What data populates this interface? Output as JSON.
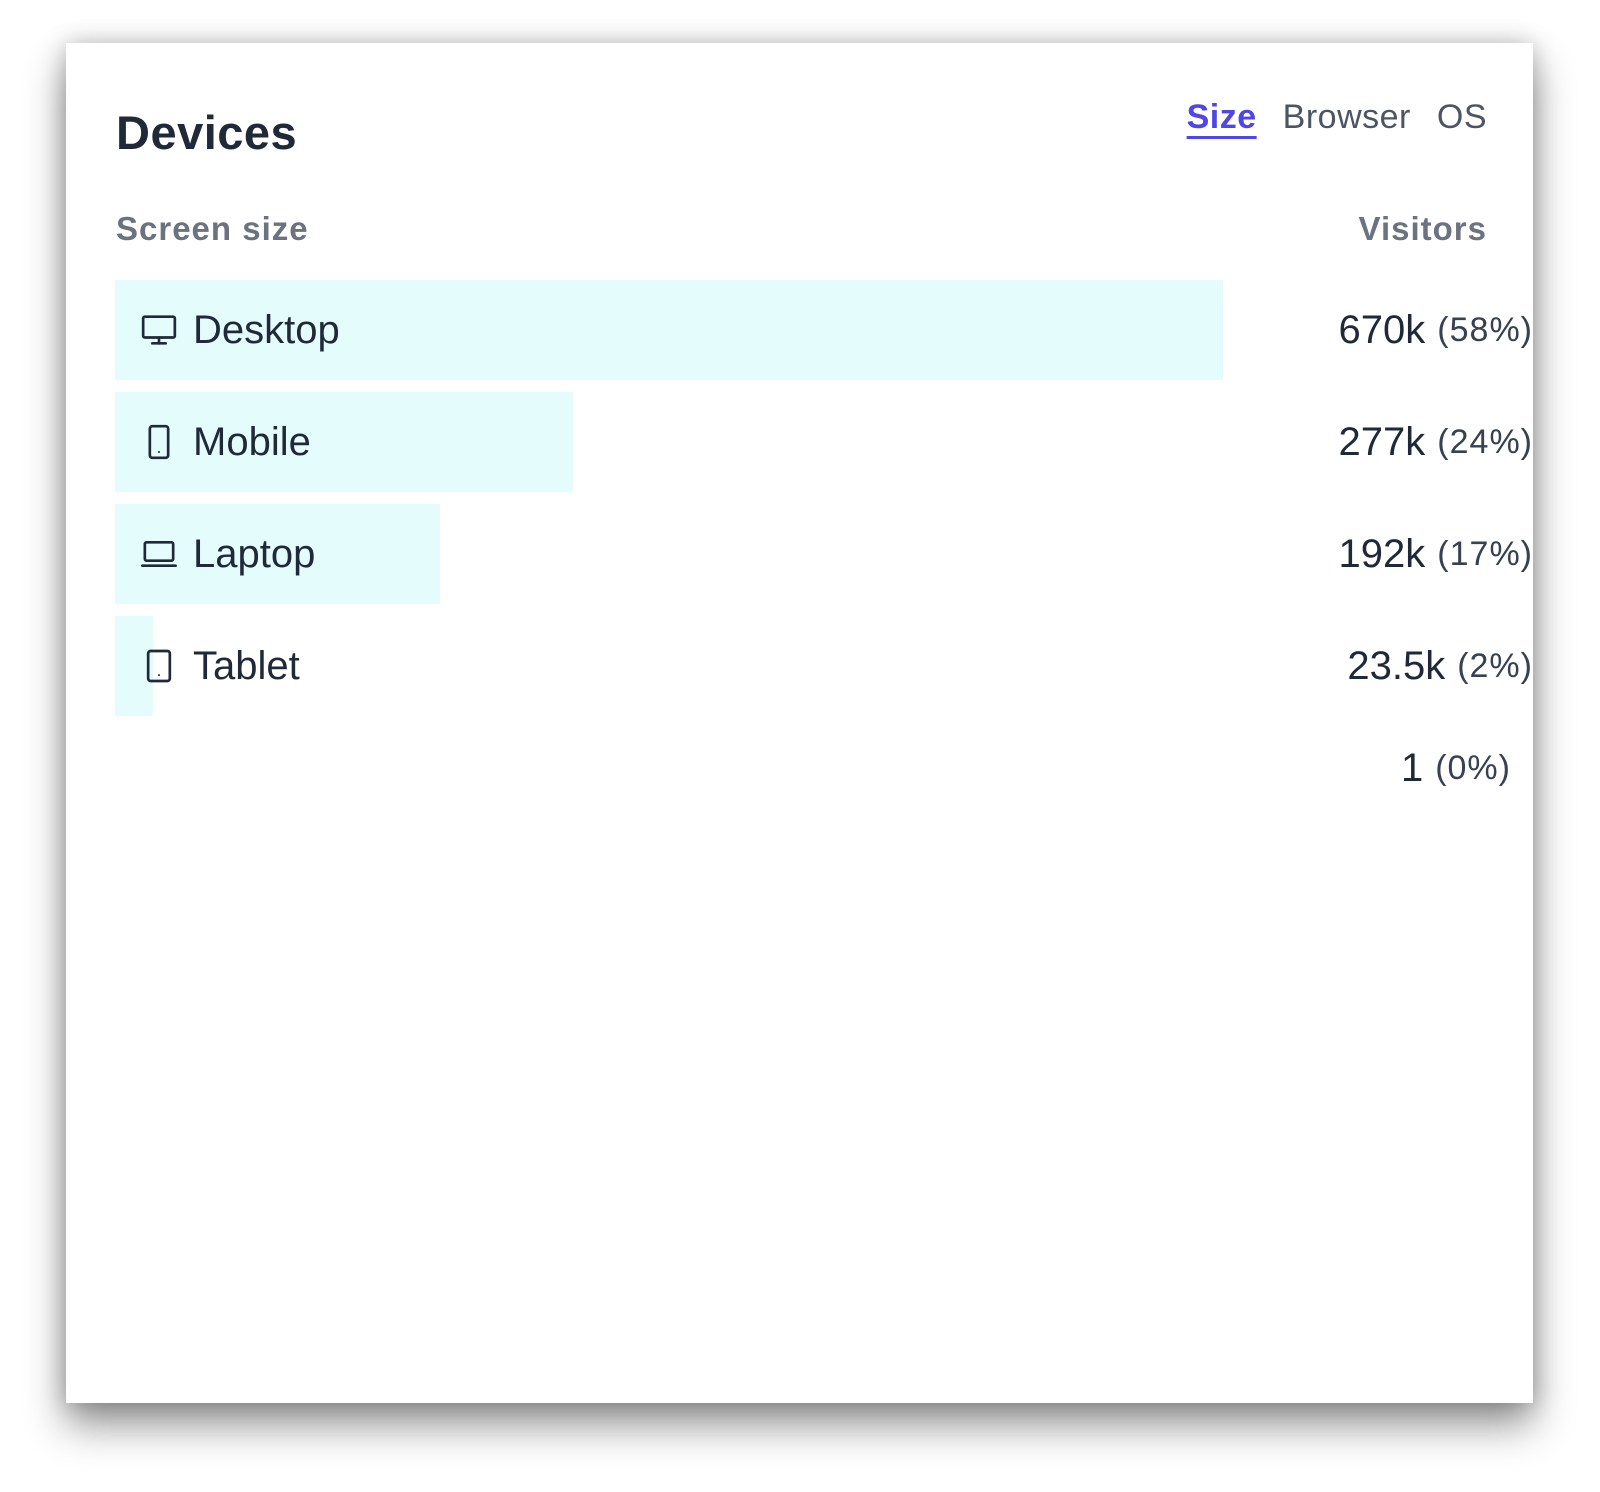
{
  "panel": {
    "title": "Devices",
    "tabs": [
      {
        "label": "Size",
        "active": true
      },
      {
        "label": "Browser",
        "active": false
      },
      {
        "label": "OS",
        "active": false
      }
    ],
    "columns": {
      "left": "Screen size",
      "right": "Visitors"
    },
    "rows": [
      {
        "label": "Desktop",
        "icon": "desktop-icon",
        "value": "670k",
        "percent": "(58%)",
        "share": 0.58
      },
      {
        "label": "Mobile",
        "icon": "mobile-icon",
        "value": "277k",
        "percent": "(24%)",
        "share": 0.24
      },
      {
        "label": "Laptop",
        "icon": "laptop-icon",
        "value": "192k",
        "percent": "(17%)",
        "share": 0.17
      },
      {
        "label": "Tablet",
        "icon": "tablet-icon",
        "value": "23.5k",
        "percent": "(2%)",
        "share": 0.02
      },
      {
        "label": "",
        "icon": "",
        "value": "1",
        "percent": "(0%)",
        "share": 0.0
      }
    ]
  },
  "colors": {
    "accent": "#4f46e5",
    "bar": "#e4fcfc",
    "text": "#1f2937",
    "muted": "#6b7280"
  }
}
